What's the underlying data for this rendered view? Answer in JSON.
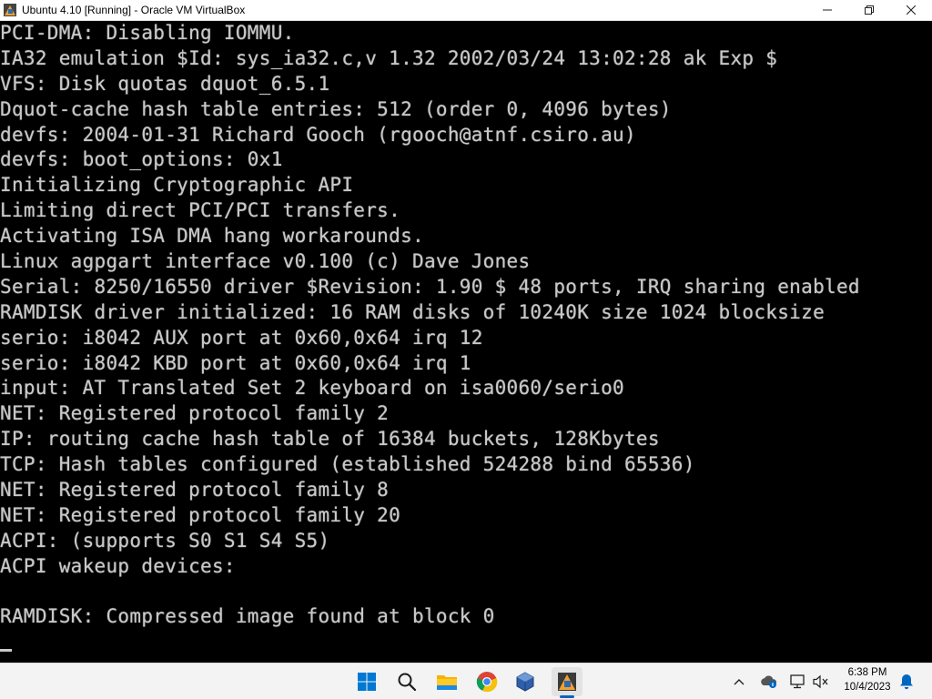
{
  "window": {
    "title": "Ubuntu 4.10 [Running] - Oracle VM VirtualBox",
    "icon": "virtualbox-icon",
    "controls": [
      "minimize-icon",
      "maximize-icon",
      "close-icon"
    ]
  },
  "console": {
    "lines": [
      "PCI-DMA: Disabling IOMMU.",
      "IA32 emulation $Id: sys_ia32.c,v 1.32 2002/03/24 13:02:28 ak Exp $",
      "VFS: Disk quotas dquot_6.5.1",
      "Dquot-cache hash table entries: 512 (order 0, 4096 bytes)",
      "devfs: 2004-01-31 Richard Gooch (rgooch@atnf.csiro.au)",
      "devfs: boot_options: 0x1",
      "Initializing Cryptographic API",
      "Limiting direct PCI/PCI transfers.",
      "Activating ISA DMA hang workarounds.",
      "Linux agpgart interface v0.100 (c) Dave Jones",
      "Serial: 8250/16550 driver $Revision: 1.90 $ 48 ports, IRQ sharing enabled",
      "RAMDISK driver initialized: 16 RAM disks of 10240K size 1024 blocksize",
      "serio: i8042 AUX port at 0x60,0x64 irq 12",
      "serio: i8042 KBD port at 0x60,0x64 irq 1",
      "input: AT Translated Set 2 keyboard on isa0060/serio0",
      "NET: Registered protocol family 2",
      "IP: routing cache hash table of 16384 buckets, 128Kbytes",
      "TCP: Hash tables configured (established 524288 bind 65536)",
      "NET: Registered protocol family 8",
      "NET: Registered protocol family 20",
      "ACPI: (supports S0 S1 S4 S5)",
      "ACPI wakeup devices:",
      "",
      "RAMDISK: Compressed image found at block 0"
    ]
  },
  "taskbar": {
    "apps": [
      "start-icon",
      "search-icon",
      "file-explorer-icon",
      "chrome-icon",
      "virtualbox-manager-icon",
      "virtualbox-vm-icon"
    ],
    "tray": [
      "chevron-up-icon",
      "onedrive-icon",
      "network-icon",
      "volume-muted-icon",
      "notification-bell-icon"
    ],
    "time": "6:38 PM",
    "date": "10/4/2023"
  },
  "colors": {
    "console_text": "#c8c8c8",
    "console_bg": "#000000",
    "taskbar_bg": "#f3f3f3",
    "accent": "#0067c0"
  }
}
